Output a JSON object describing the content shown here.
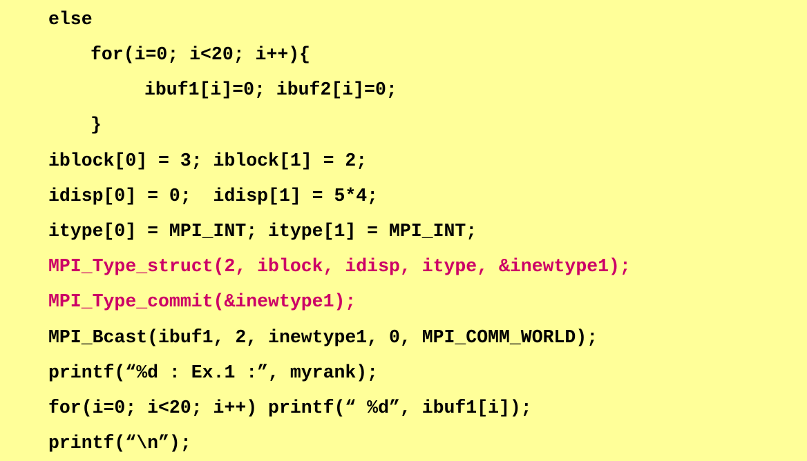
{
  "code": {
    "lines": [
      {
        "text": "else",
        "highlight": false
      },
      {
        "text": "for(i=0; i<20; i++){",
        "highlight": false
      },
      {
        "text": "ibuf1[i]=0; ibuf2[i]=0;",
        "highlight": false
      },
      {
        "text": "}",
        "highlight": false
      },
      {
        "text": "iblock[0] = 3; iblock[1] = 2;",
        "highlight": false
      },
      {
        "text": "idisp[0] = 0;  idisp[1] = 5*4;",
        "highlight": false
      },
      {
        "text": "itype[0] = MPI_INT; itype[1] = MPI_INT;",
        "highlight": false
      },
      {
        "text": "MPI_Type_struct(2, iblock, idisp, itype, &inewtype1);",
        "highlight": true
      },
      {
        "text": "MPI_Type_commit(&inewtype1);",
        "highlight": true
      },
      {
        "text": "MPI_Bcast(ibuf1, 2, inewtype1, 0, MPI_COMM_WORLD);",
        "highlight": false
      },
      {
        "text": "printf(“%d : Ex.1 :”, myrank);",
        "highlight": false
      },
      {
        "text": "for(i=0; i<20; i++) printf(“ %d”, ibuf1[i]);",
        "highlight": false
      },
      {
        "text": "printf(“\\n”);",
        "highlight": false
      }
    ]
  },
  "colors": {
    "background": "#ffff99",
    "text": "#000000",
    "highlight": "#cc0066"
  }
}
